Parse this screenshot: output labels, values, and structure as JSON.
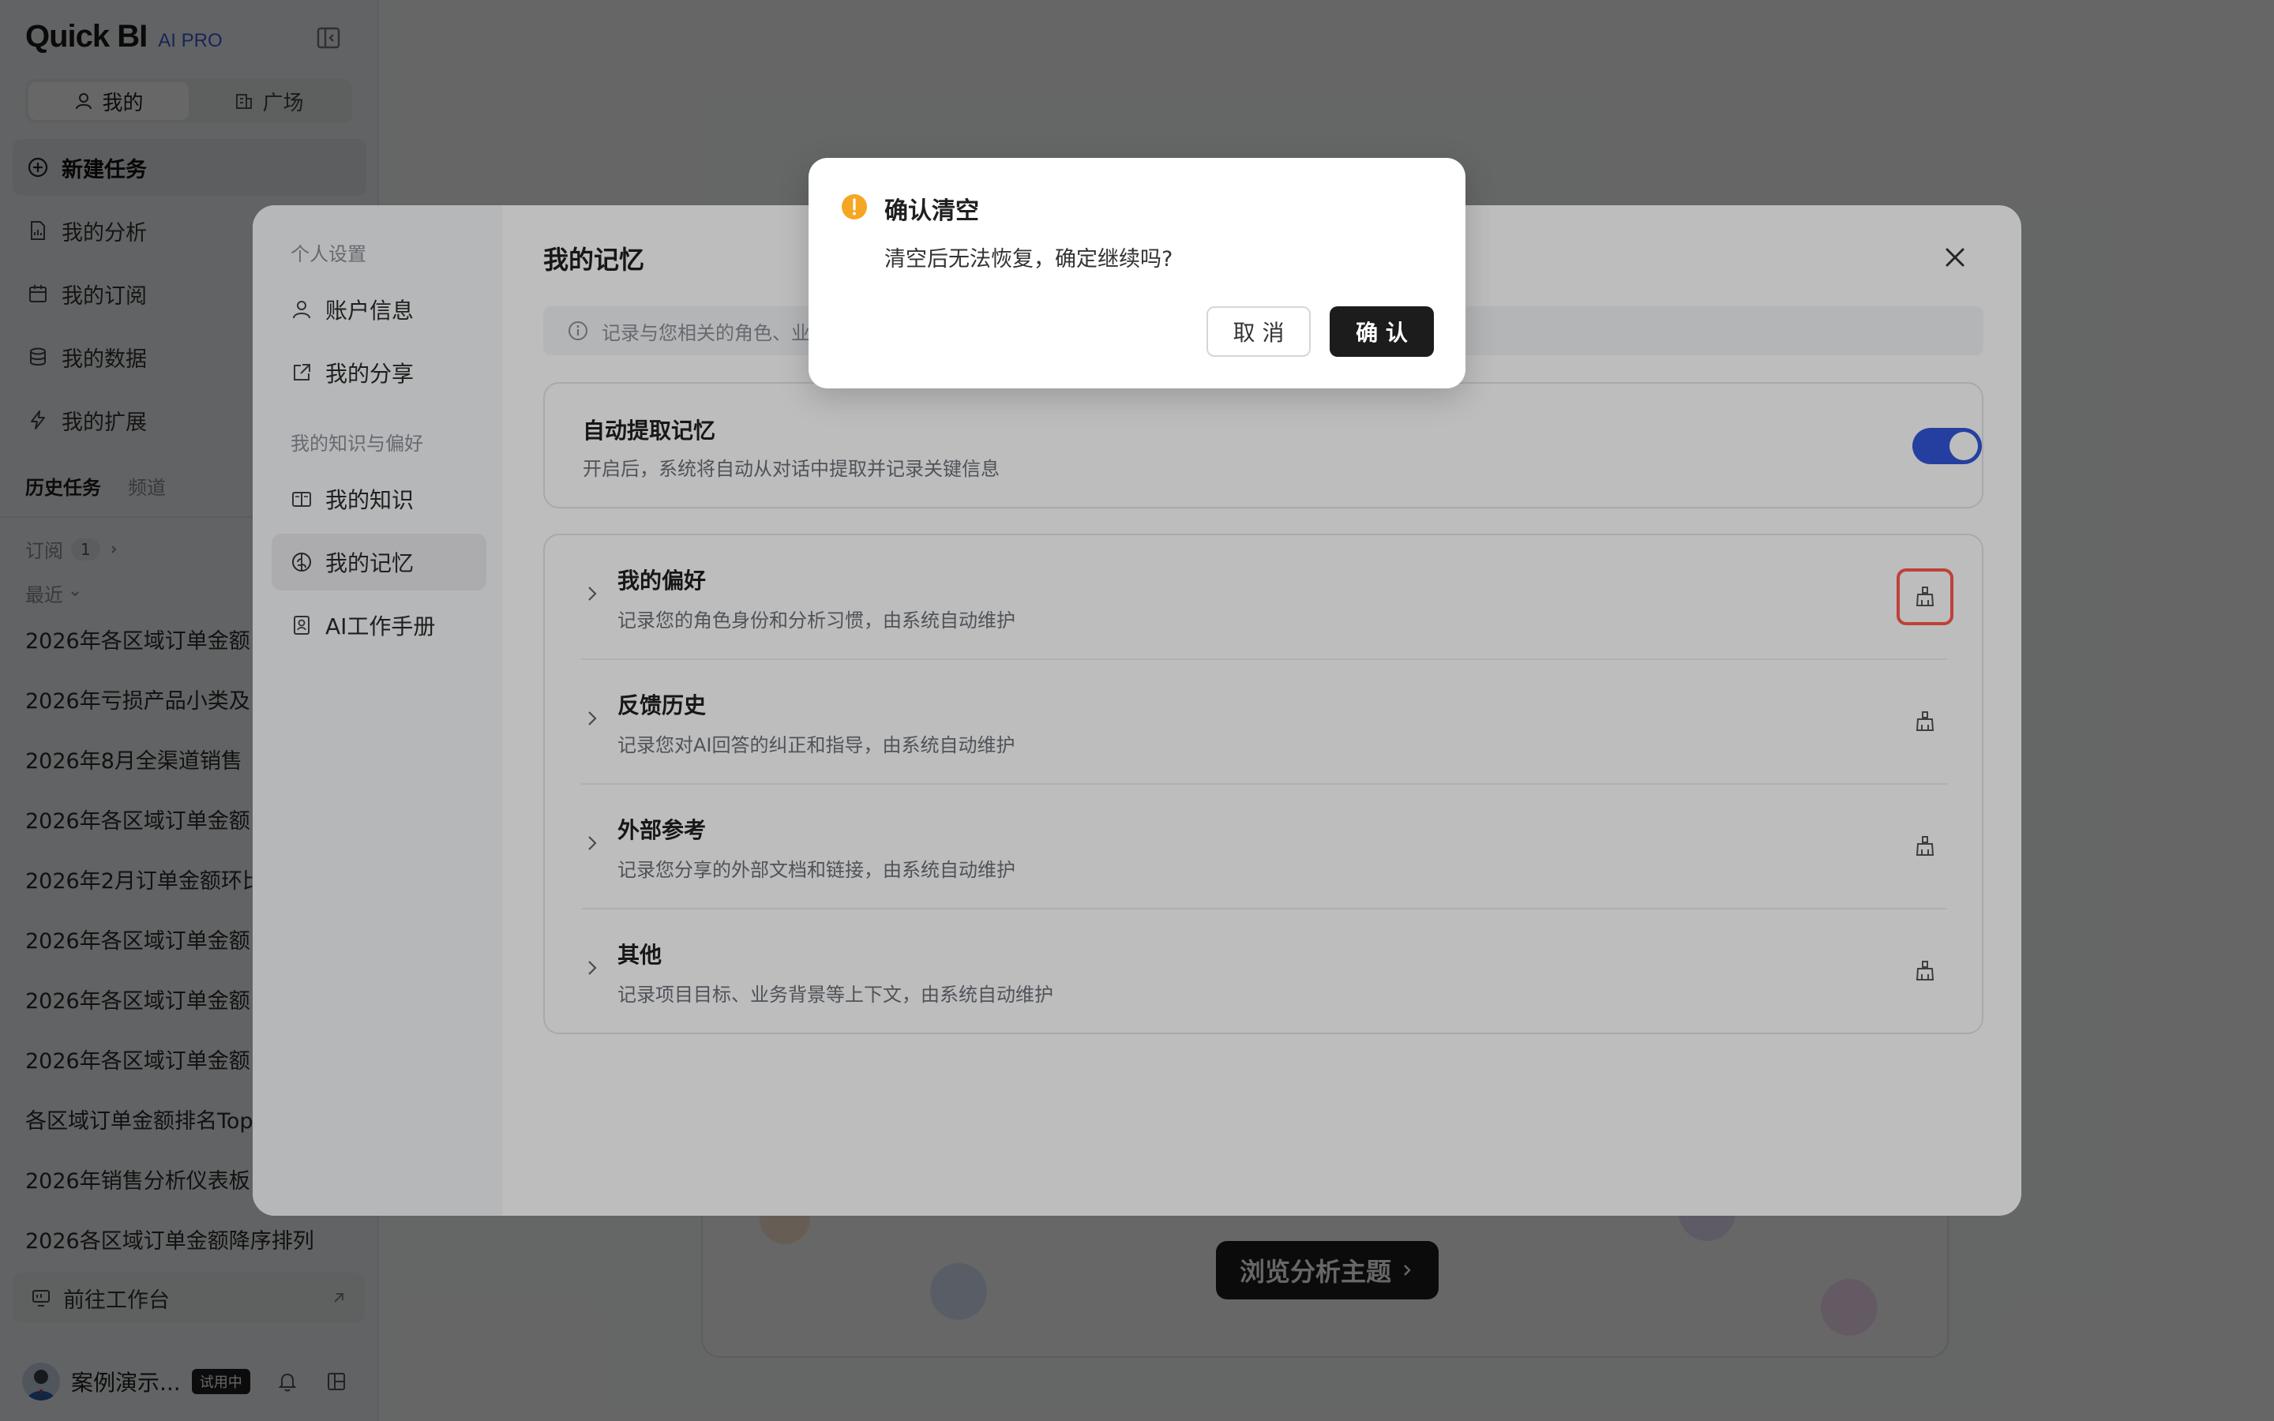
{
  "app": {
    "logo": "Quick BI",
    "badge": "AI PRO"
  },
  "sidebar": {
    "scope_tabs": [
      {
        "label": "我的"
      },
      {
        "label": "广场"
      }
    ],
    "nav": [
      {
        "label": "新建任务"
      },
      {
        "label": "我的分析"
      },
      {
        "label": "我的订阅"
      },
      {
        "label": "我的数据"
      },
      {
        "label": "我的扩展"
      }
    ],
    "history_tabs": [
      {
        "label": "历史任务"
      },
      {
        "label": "频道"
      }
    ],
    "subscriptions_label": "订阅",
    "subscriptions_count": "1",
    "recent_label": "最近",
    "history": [
      "2026年各区域订单金额",
      "2026年亏损产品小类及",
      "2026年8月全渠道销售",
      "2026年各区域订单金额",
      "2026年2月订单金额环比",
      "2026年各区域订单金额",
      "2026年各区域订单金额",
      "2026年各区域订单金额",
      "各区域订单金额排名Top",
      "2026年销售分析仪表板",
      "2026各区域订单金额降序排列"
    ],
    "workspace_link": "前往工作台",
    "user": {
      "name": "案例演示...",
      "badge": "试用中"
    }
  },
  "main": {
    "browse_button": "浏览分析主题"
  },
  "settings": {
    "group_personal": "个人设置",
    "group_knowledge": "我的知识与偏好",
    "items": [
      {
        "label": "账户信息"
      },
      {
        "label": "我的分享"
      },
      {
        "label": "我的知识"
      },
      {
        "label": "我的记忆"
      },
      {
        "label": "AI工作手册"
      }
    ],
    "title": "我的记忆",
    "info_text": "记录与您相关的角色、业",
    "auto_memory": {
      "title": "自动提取记忆",
      "desc": "开启后，系统将自动从对话中提取并记录关键信息",
      "enabled": true
    },
    "memory_rows": [
      {
        "title": "我的偏好",
        "desc": "记录您的角色身份和分析习惯，由系统自动维护"
      },
      {
        "title": "反馈历史",
        "desc": "记录您对AI回答的纠正和指导，由系统自动维护"
      },
      {
        "title": "外部参考",
        "desc": "记录您分享的外部文档和链接，由系统自动维护"
      },
      {
        "title": "其他",
        "desc": "记录项目目标、业务背景等上下文，由系统自动维护"
      }
    ]
  },
  "confirm_dialog": {
    "title": "确认清空",
    "message": "清空后无法恢复，确定继续吗?",
    "cancel_label": "取 消",
    "confirm_label": "确 认"
  },
  "colors": {
    "accent": "#3355d9",
    "warning": "#f5a623",
    "highlight": "#ff5a4e",
    "primary_button": "#1c1c1c"
  }
}
